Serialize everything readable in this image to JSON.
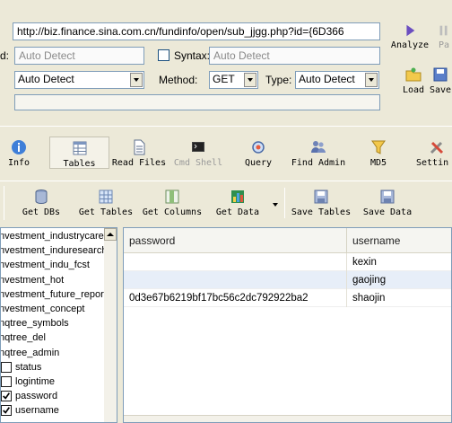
{
  "request": {
    "url": "http://biz.finance.sina.com.cn/fundinfo/open/sub_jjgg.php?id={6D366",
    "field_left_value": "Auto Detect",
    "field_left_label": "d:",
    "syntax_label": "Syntax:",
    "syntax_value": "Auto Detect",
    "encoding_value": "Auto Detect",
    "method_label": "Method:",
    "method_value": "GET",
    "type_label": "Type:",
    "type_value": "Auto Detect",
    "post_data": ""
  },
  "side_actions": {
    "analyze": "Analyze",
    "paste": "Pa",
    "load": "Load",
    "save": "Save"
  },
  "main_toolbar": {
    "info": "Info",
    "tables": "Tables",
    "read_files": "Read Files",
    "cmd_shell": "Cmd Shell",
    "query": "Query",
    "find_admin": "Find Admin",
    "md5": "MD5",
    "settings": "Settin"
  },
  "db_toolbar": {
    "get_dbs": "Get DBs",
    "get_tables": "Get Tables",
    "get_columns": "Get Columns",
    "get_data": "Get Data",
    "save_tables": "Save Tables",
    "save_data": "Save Data"
  },
  "tree": {
    "tables": [
      "nvestment_industrycare",
      "nvestment_induresearch",
      "nvestment_indu_fcst",
      "nvestment_hot",
      "nvestment_future_report",
      "nvestment_concept",
      "nqtree_symbols",
      "nqtree_del",
      "nqtree_admin"
    ],
    "columns": [
      {
        "name": "status",
        "checked": false
      },
      {
        "name": "logintime",
        "checked": false
      },
      {
        "name": "password",
        "checked": true
      },
      {
        "name": "username",
        "checked": true
      }
    ]
  },
  "grid": {
    "headers": [
      "password",
      "username"
    ],
    "rows": [
      [
        "",
        "kexin"
      ],
      [
        "",
        "gaojing"
      ],
      [
        "0d3e67b6219bf17bc56c2dc792922ba2",
        "shaojin"
      ]
    ],
    "selected_row": 1
  },
  "colors": {
    "window_bg": "#ece9d8",
    "field_border": "#7f9db9",
    "selected_row": "#e7eef8"
  }
}
